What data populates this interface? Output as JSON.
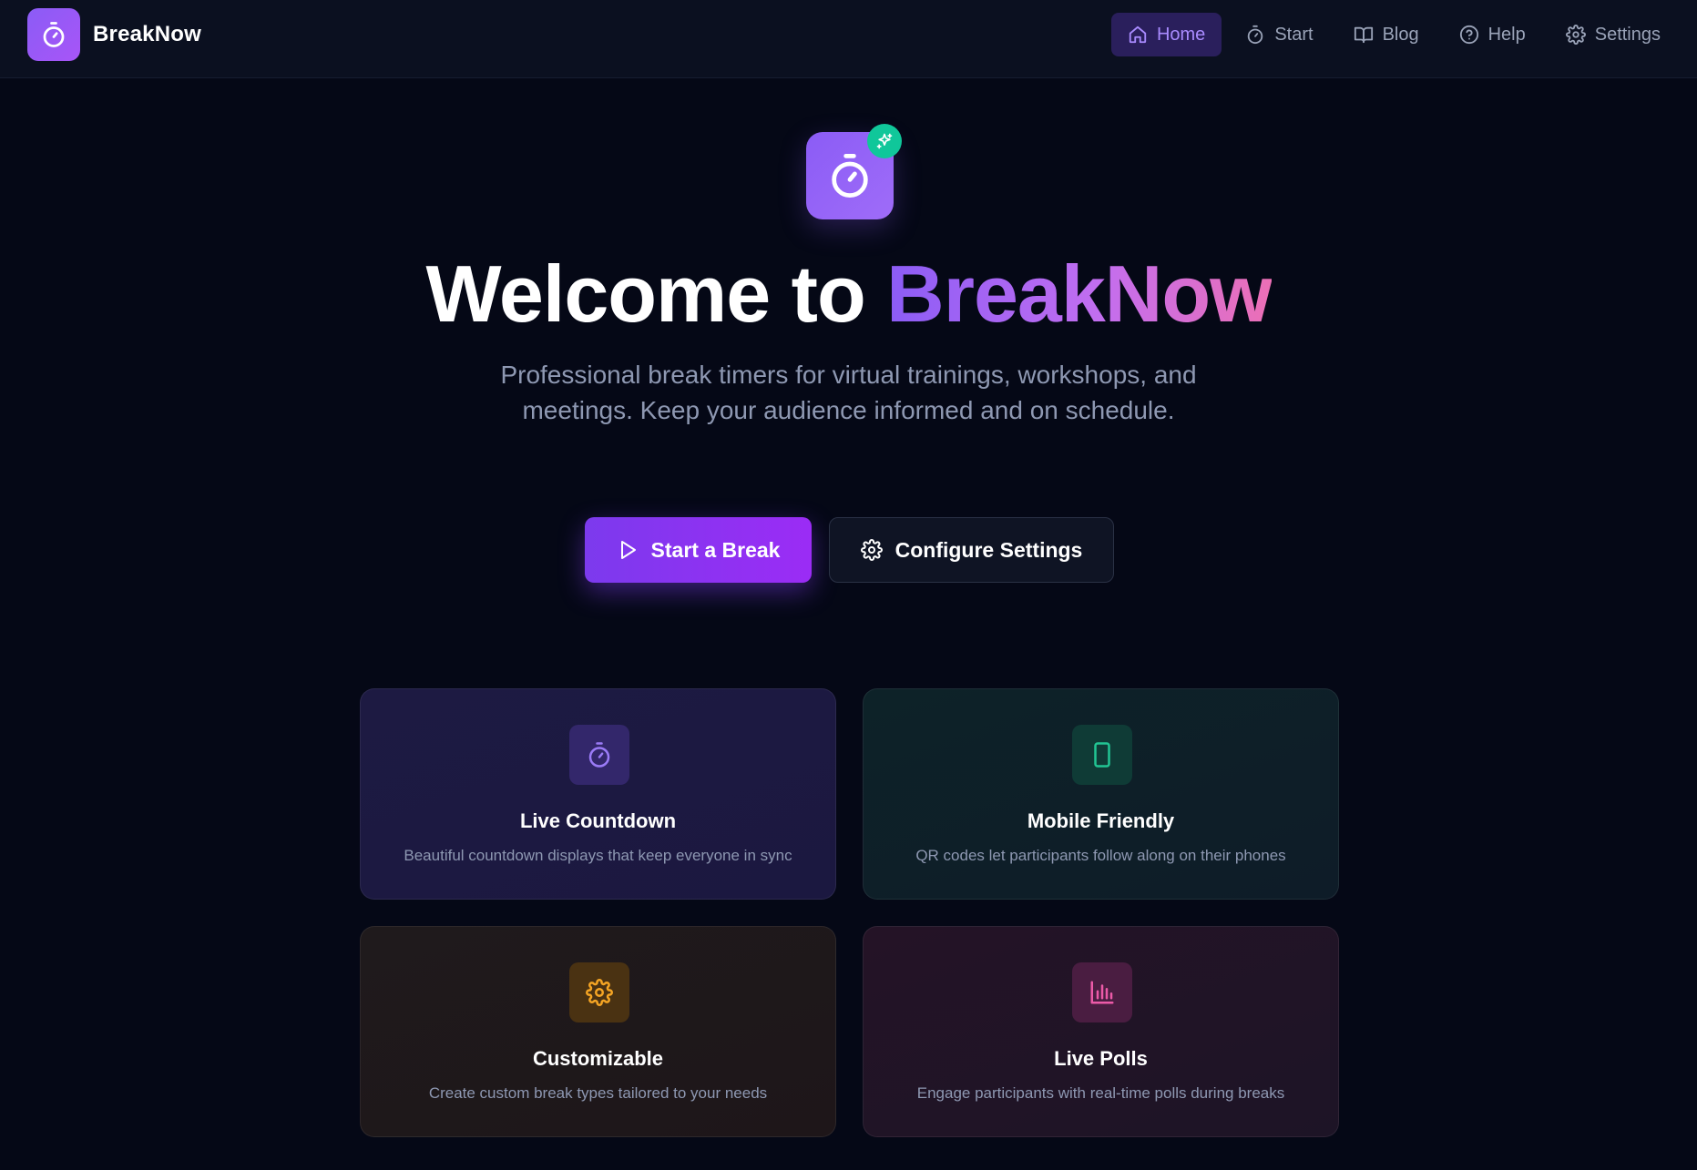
{
  "brand": {
    "name": "BreakNow"
  },
  "nav": {
    "items": [
      {
        "label": "Home",
        "icon": "home-icon",
        "active": true
      },
      {
        "label": "Start",
        "icon": "timer-icon",
        "active": false
      },
      {
        "label": "Blog",
        "icon": "book-icon",
        "active": false
      },
      {
        "label": "Help",
        "icon": "help-circle-icon",
        "active": false
      },
      {
        "label": "Settings",
        "icon": "gear-icon",
        "active": false
      }
    ]
  },
  "hero": {
    "title_prefix": "Welcome to ",
    "title_brand": "BreakNow",
    "subtitle": "Professional break timers for virtual trainings, workshops, and meetings. Keep your audience informed and on schedule."
  },
  "cta": {
    "primary_label": "Start a Break",
    "secondary_label": "Configure Settings"
  },
  "features": [
    {
      "title": "Live Countdown",
      "description": "Beautiful countdown displays that keep everyone in sync",
      "icon": "timer-icon",
      "accent": "#8b5cf6"
    },
    {
      "title": "Mobile Friendly",
      "description": "QR codes let participants follow along on their phones",
      "icon": "smartphone-icon",
      "accent": "#10b981"
    },
    {
      "title": "Customizable",
      "description": "Create custom break types tailored to your needs",
      "icon": "gear-icon",
      "accent": "#f59e0b"
    },
    {
      "title": "Live Polls",
      "description": "Engage participants with real-time polls during breaks",
      "icon": "bar-chart-icon",
      "accent": "#ec4899"
    }
  ],
  "colors": {
    "background": "#050816",
    "primary": "#7c3aed",
    "brand_gradient": [
      "#8b5cf6",
      "#ec6fb5"
    ],
    "badge": "#10c79a"
  }
}
